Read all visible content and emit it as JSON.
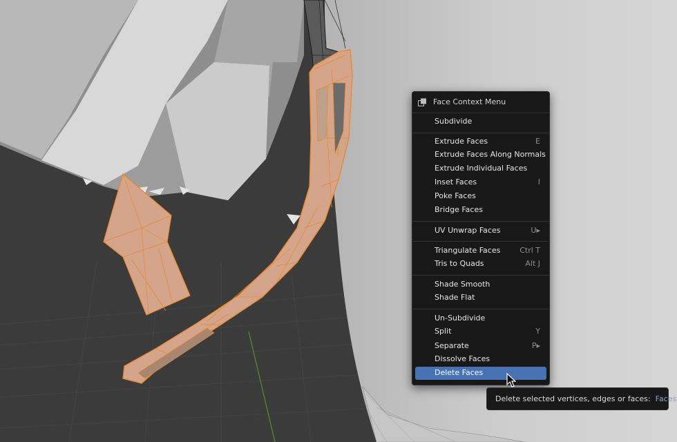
{
  "menu": {
    "title": "Face Context Menu",
    "title_icon": "menu-panel-icon",
    "items": [
      {
        "label": "Subdivide",
        "shortcut": ""
      },
      {
        "label": "Extrude Faces",
        "shortcut": "E"
      },
      {
        "label": "Extrude Faces Along Normals",
        "shortcut": ""
      },
      {
        "label": "Extrude Individual Faces",
        "shortcut": ""
      },
      {
        "label": "Inset Faces",
        "shortcut": "I"
      },
      {
        "label": "Poke Faces",
        "shortcut": ""
      },
      {
        "label": "Bridge Faces",
        "shortcut": ""
      },
      {
        "label": "UV Unwrap Faces",
        "shortcut": "U▸"
      },
      {
        "label": "Triangulate Faces",
        "shortcut": "Ctrl T"
      },
      {
        "label": "Tris to Quads",
        "shortcut": "Alt J"
      },
      {
        "label": "Shade Smooth",
        "shortcut": ""
      },
      {
        "label": "Shade Flat",
        "shortcut": ""
      },
      {
        "label": "Un-Subdivide",
        "shortcut": ""
      },
      {
        "label": "Split",
        "shortcut": "Y"
      },
      {
        "label": "Separate",
        "shortcut": "P▸"
      },
      {
        "label": "Dissolve Faces",
        "shortcut": ""
      },
      {
        "label": "Delete Faces",
        "shortcut": ""
      }
    ]
  },
  "tooltip": {
    "description": "Delete selected vertices, edges or faces:",
    "value": "Faces"
  },
  "colors": {
    "selection_orange": "#e8892c",
    "selected_face": "#d4a58a",
    "menu_highlight": "#4772b3"
  }
}
